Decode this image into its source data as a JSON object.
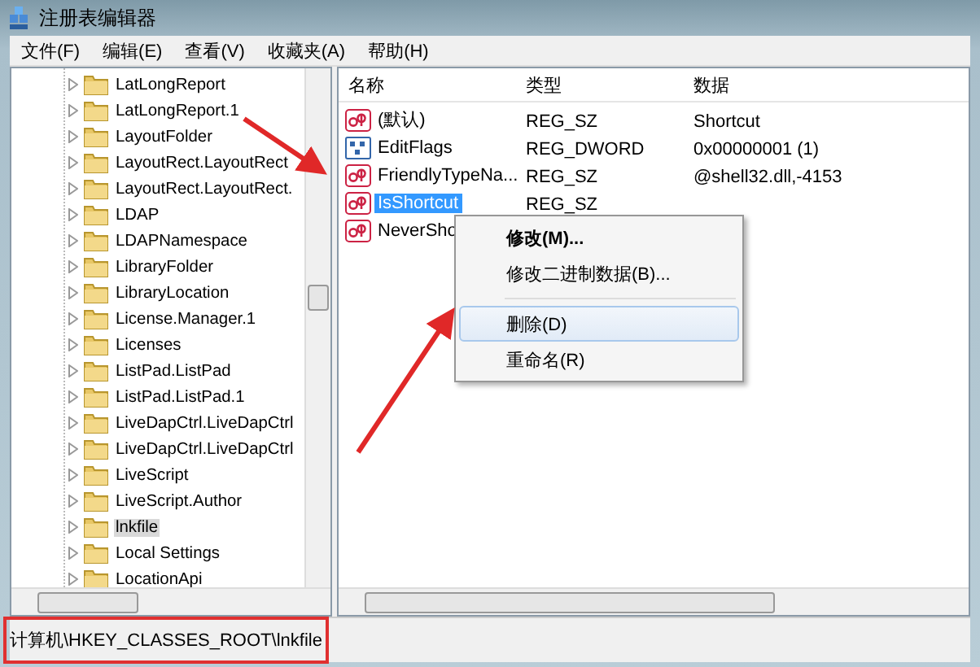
{
  "window": {
    "title": "注册表编辑器"
  },
  "menu": [
    "文件(F)",
    "编辑(E)",
    "查看(V)",
    "收藏夹(A)",
    "帮助(H)"
  ],
  "tree": {
    "items": [
      {
        "label": "LatLongReport",
        "selected": false
      },
      {
        "label": "LatLongReport.1",
        "selected": false
      },
      {
        "label": "LayoutFolder",
        "selected": false
      },
      {
        "label": "LayoutRect.LayoutRect",
        "selected": false
      },
      {
        "label": "LayoutRect.LayoutRect.",
        "selected": false
      },
      {
        "label": "LDAP",
        "selected": false
      },
      {
        "label": "LDAPNamespace",
        "selected": false
      },
      {
        "label": "LibraryFolder",
        "selected": false
      },
      {
        "label": "LibraryLocation",
        "selected": false
      },
      {
        "label": "License.Manager.1",
        "selected": false
      },
      {
        "label": "Licenses",
        "selected": false
      },
      {
        "label": "ListPad.ListPad",
        "selected": false
      },
      {
        "label": "ListPad.ListPad.1",
        "selected": false
      },
      {
        "label": "LiveDapCtrl.LiveDapCtrl",
        "selected": false
      },
      {
        "label": "LiveDapCtrl.LiveDapCtrl",
        "selected": false
      },
      {
        "label": "LiveScript",
        "selected": false
      },
      {
        "label": "LiveScript.Author",
        "selected": false
      },
      {
        "label": "lnkfile",
        "selected": true
      },
      {
        "label": "Local Settings",
        "selected": false
      },
      {
        "label": "LocationApi",
        "selected": false
      }
    ]
  },
  "values": {
    "columns": [
      "名称",
      "类型",
      "数据"
    ],
    "rows": [
      {
        "kind": "string",
        "name": "(默认)",
        "type": "REG_SZ",
        "data": "Shortcut",
        "selected": false
      },
      {
        "kind": "binary",
        "name": "EditFlags",
        "type": "REG_DWORD",
        "data": "0x00000001 (1)",
        "selected": false
      },
      {
        "kind": "string",
        "name": "FriendlyTypeNa...",
        "type": "REG_SZ",
        "data": "@shell32.dll,-4153",
        "selected": false
      },
      {
        "kind": "string",
        "name": "IsShortcut",
        "type": "REG_SZ",
        "selected": true
      },
      {
        "kind": "string",
        "name": "NeverSho",
        "selected": false
      }
    ]
  },
  "context_menu": {
    "items": [
      {
        "kind": "item",
        "label": "修改(M)...",
        "default": true,
        "selected": false
      },
      {
        "kind": "item",
        "label": "修改二进制数据(B)...",
        "default": false,
        "selected": false
      },
      {
        "kind": "separator"
      },
      {
        "kind": "item",
        "label": "删除(D)",
        "default": false,
        "selected": true
      },
      {
        "kind": "item",
        "label": "重命名(R)",
        "default": false,
        "selected": false
      }
    ]
  },
  "status_bar": {
    "path": "计算机\\HKEY_CLASSES_ROOT\\lnkfile"
  }
}
